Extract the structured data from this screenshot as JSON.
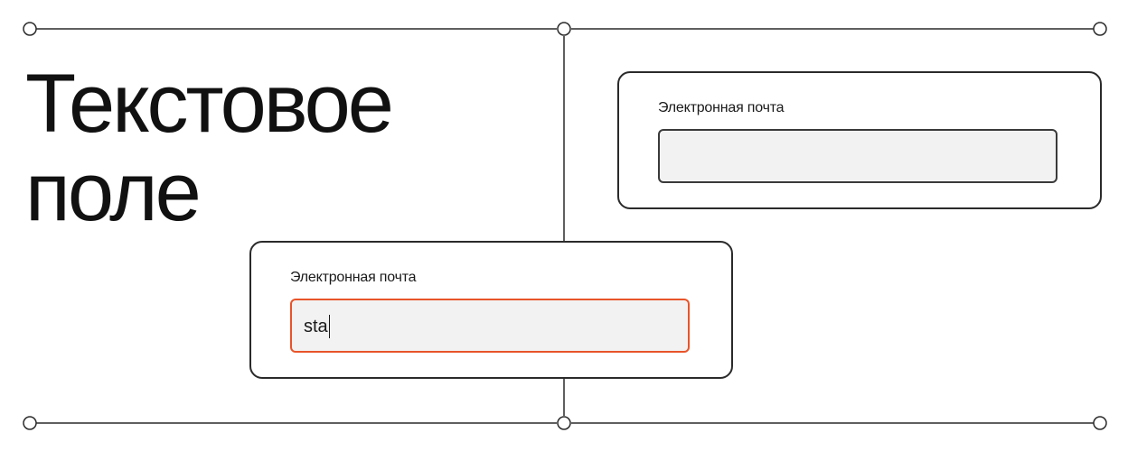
{
  "title": {
    "line1": "Текстовое",
    "line2": "поле"
  },
  "email_card_empty": {
    "label": "Электронная почта",
    "value": ""
  },
  "email_card_active": {
    "label": "Электронная почта",
    "value": "sta",
    "state": "focused"
  },
  "colors": {
    "focus_border": "#e8542a",
    "input_fill": "#f2f2f2",
    "line": "#2a2a2a"
  }
}
